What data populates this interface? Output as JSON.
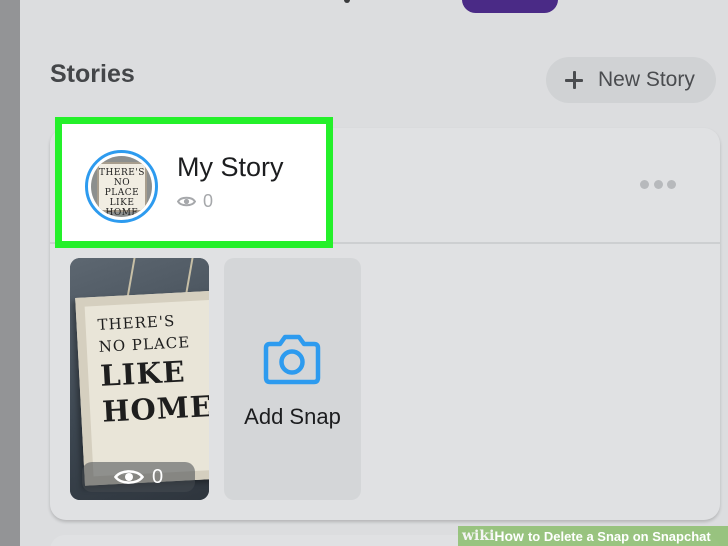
{
  "stories_section": {
    "title": "Stories",
    "new_story_label": "New Story"
  },
  "my_story": {
    "name": "My Story",
    "view_count": "0",
    "avatar_sign_lines": [
      "THERE'S",
      "NO PLACE",
      "LIKE",
      "HOME"
    ]
  },
  "snaps": [
    {
      "sign_lines": [
        "THERE'S",
        "NO PLACE",
        "LIKE",
        "HOME"
      ],
      "view_count": "0"
    }
  ],
  "add_snap": {
    "label": "Add Snap"
  },
  "watermark": {
    "wiki": "wiki",
    "how": "How",
    "text": "to Delete a Snap on Snapchat"
  },
  "colors": {
    "highlight_box": "#24f02a",
    "avatar_ring": "#2d9bef",
    "camera_icon": "#2d9bef",
    "top_pill": "#4a2a86"
  },
  "icons": {
    "new_story": "plus-icon",
    "story_menu": "more-icon",
    "views": "eye-icon",
    "add_snap": "camera-icon"
  }
}
